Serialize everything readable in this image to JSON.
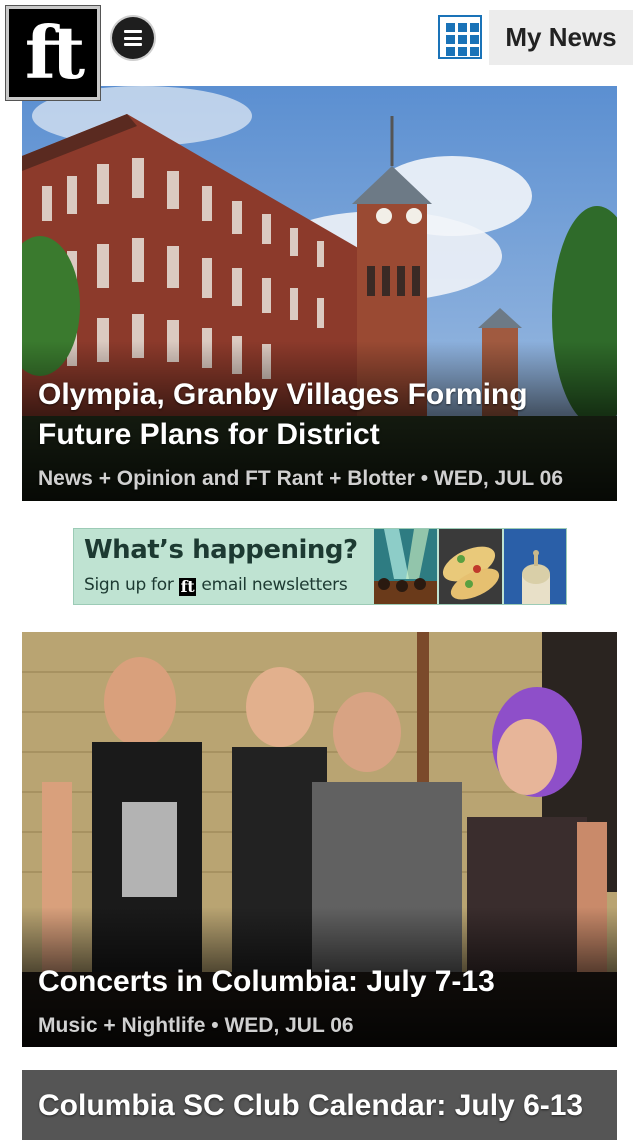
{
  "header": {
    "logo_text": "ft",
    "menu_icon": "hamburger-menu-icon",
    "grid_icon": "grid-icon",
    "accent_color": "#1a73b8",
    "my_news_label": "My News"
  },
  "articles": [
    {
      "title": "Olympia, Granby Villages Forming Future Plans for District",
      "meta": "News + Opinion and FT Rant + Blotter • WED, JUL 06"
    },
    {
      "title": "Concerts in Columbia: July 7-13",
      "meta": "Music + Nightlife • WED, JUL 06"
    },
    {
      "title": "Columbia SC Club Calendar: July 6-13"
    }
  ],
  "ad": {
    "headline": "What’s happening?",
    "sub_before": "Sign up for ",
    "sub_logo": "ft",
    "sub_after": " email newsletters"
  }
}
